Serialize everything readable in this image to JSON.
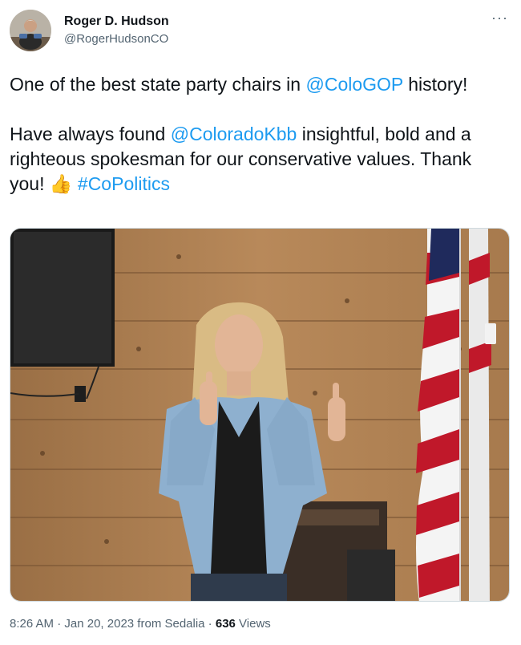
{
  "author": {
    "display_name": "Roger D. Hudson",
    "handle": "@RogerHudsonCO"
  },
  "more_icon": "more-horizontal-icon",
  "tweet": {
    "line1_prefix": "One of the best state party chairs in ",
    "line1_mention": "@ColoGOP",
    "line1_suffix": " history!",
    "line2_prefix": "Have always found ",
    "line2_mention": "@ColoradoKbb",
    "line2_middle": " insightful, bold and a righteous spokesman for our conservative values. Thank you! ",
    "emoji": "👍",
    "hashtag": "#CoPolitics"
  },
  "meta": {
    "time": "8:26 AM",
    "separator1": " · ",
    "date": "Jan 20, 2023",
    "source": " from Sedalia",
    "separator2": " · ",
    "views_count": "636",
    "views_label": " Views"
  },
  "colors": {
    "link": "#1d9bf0",
    "secondary_text": "#536471",
    "primary_text": "#0f1419"
  }
}
